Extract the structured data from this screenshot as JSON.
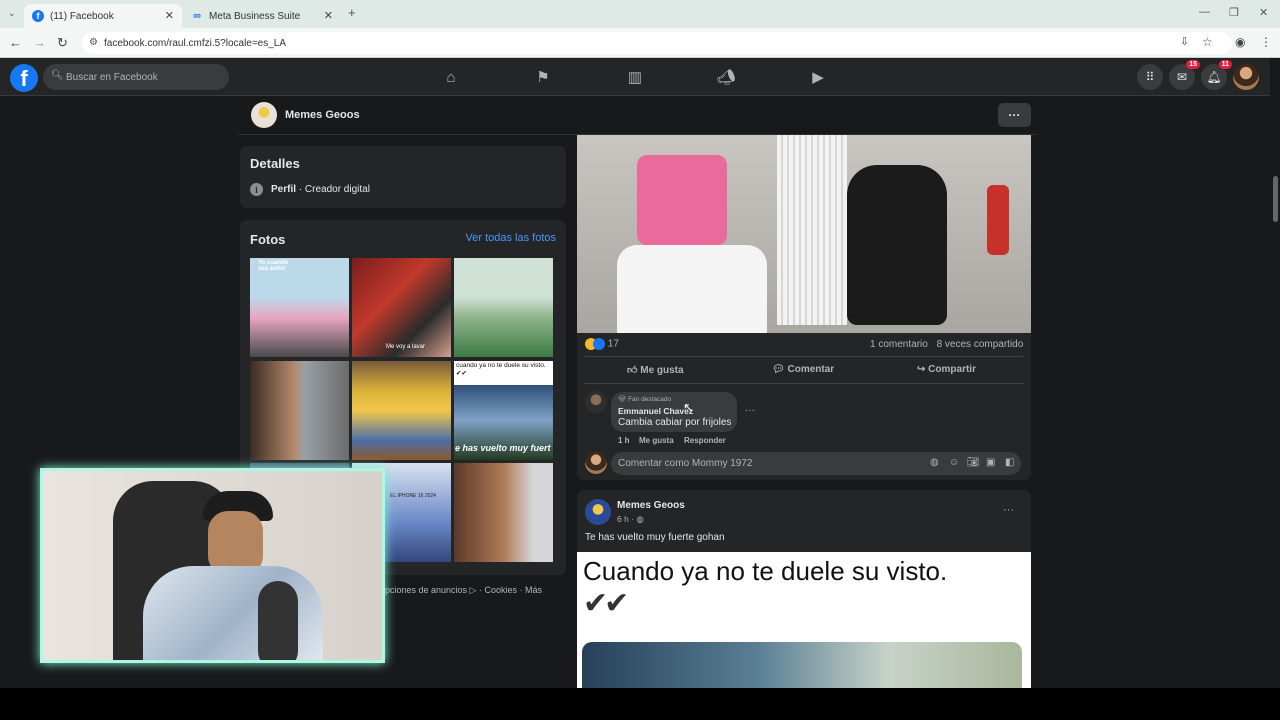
{
  "browser": {
    "tabs": [
      {
        "title": "(11) Facebook",
        "active": true
      },
      {
        "title": "Meta Business Suite",
        "active": false
      }
    ],
    "new_tab": "+",
    "url": "facebook.com/raul.cmfzi.5?locale=es_LA"
  },
  "header": {
    "logo": "f",
    "search_placeholder": "Buscar en Facebook",
    "messenger_badge": "15",
    "notifications_badge": "11"
  },
  "page_bar": {
    "name": "Memes Geoos",
    "more": "···"
  },
  "details": {
    "title": "Detalles",
    "profile_label": "Perfil",
    "profile_text": " · Creador digital"
  },
  "photos": {
    "title": "Fotos",
    "see_all": "Ver todas las fotos",
    "captions": [
      "Yo cuando sea señor",
      "Me voy a lavar",
      "cuando ya no te duele su visto. ✔✔",
      "e has vuelto muy fuert",
      "EL IPHONE 16 2024"
    ]
  },
  "footer": {
    "links": "Opciones de anuncios ▷ · Cookies · Más"
  },
  "post1": {
    "reaction_count": "17",
    "comments": "1 comentario",
    "shares": "8 veces compartido",
    "like": "Me gusta",
    "comment": "Comentar",
    "share": "Compartir"
  },
  "comment": {
    "badge": "Fan destacado",
    "author": "Emmanuel Chavez",
    "text": "Cambia cabiar por frijoles",
    "time": "1 h",
    "like": "Me gusta",
    "reply": "Responder",
    "more": "···"
  },
  "comment_input": {
    "placeholder": "Comentar como Mommy 1972"
  },
  "post2": {
    "author": "Memes Geoos",
    "time": "6 h ·",
    "caption": "Te has vuelto muy fuerte gohan",
    "meme_text": "Cuando ya no te duele su visto.",
    "meme_checks": "✔✔",
    "more": "···"
  },
  "colors": {
    "fb_blue": "#1877f2",
    "link": "#4599ff",
    "badge_red": "#e41e3f",
    "surface": "#242526",
    "background": "#18191a",
    "cam_border": "#aef7e2"
  }
}
